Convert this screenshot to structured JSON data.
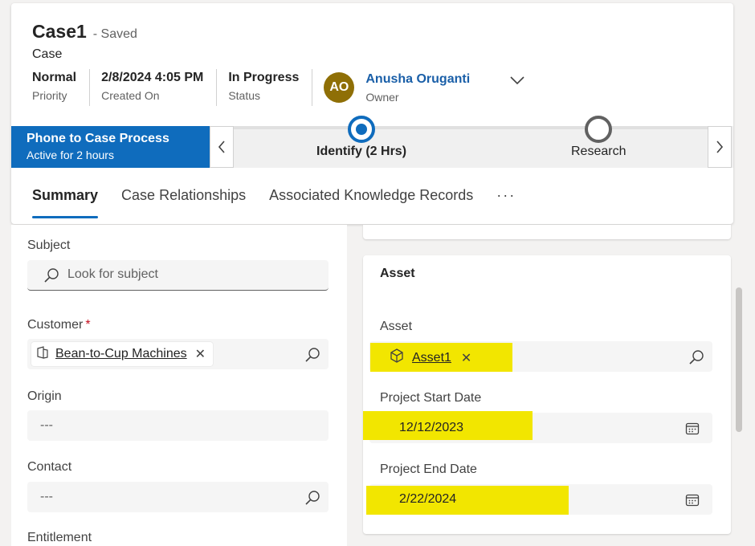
{
  "header": {
    "title": "Case1",
    "saved_status": "- Saved",
    "entity": "Case",
    "fields": [
      {
        "value": "Normal",
        "label": "Priority"
      },
      {
        "value": "2/8/2024 4:05 PM",
        "label": "Created On"
      },
      {
        "value": "In Progress",
        "label": "Status"
      }
    ],
    "owner": {
      "initials": "AO",
      "name": "Anusha Oruganti",
      "label": "Owner",
      "avatar_color": "#8f6f06"
    }
  },
  "process": {
    "name": "Phone to Case Process",
    "status": "Active for 2 hours",
    "stages": [
      {
        "label": "Identify  (2 Hrs)",
        "state": "active"
      },
      {
        "label": "Research",
        "state": "pending"
      }
    ],
    "accent": "#0f6cbd"
  },
  "tabs": [
    {
      "label": "Summary",
      "active": true
    },
    {
      "label": "Case Relationships",
      "active": false
    },
    {
      "label": "Associated Knowledge Records",
      "active": false
    },
    {
      "label": "···",
      "active": false
    }
  ],
  "left_form": {
    "subject": {
      "label": "Subject",
      "placeholder": "Look for subject"
    },
    "customer": {
      "label": "Customer",
      "required_mark": "*",
      "value": "Bean-to-Cup Machines"
    },
    "origin": {
      "label": "Origin",
      "value": "---"
    },
    "contact": {
      "label": "Contact",
      "value": "---"
    },
    "entitlement": {
      "label": "Entitlement"
    }
  },
  "asset_section": {
    "title": "Asset",
    "asset": {
      "label": "Asset",
      "value": "Asset1"
    },
    "start_date": {
      "label": "Project Start Date",
      "value": "12/12/2023"
    },
    "end_date": {
      "label": "Project End Date",
      "value": "2/22/2024"
    },
    "highlight_color": "#f2e600"
  }
}
